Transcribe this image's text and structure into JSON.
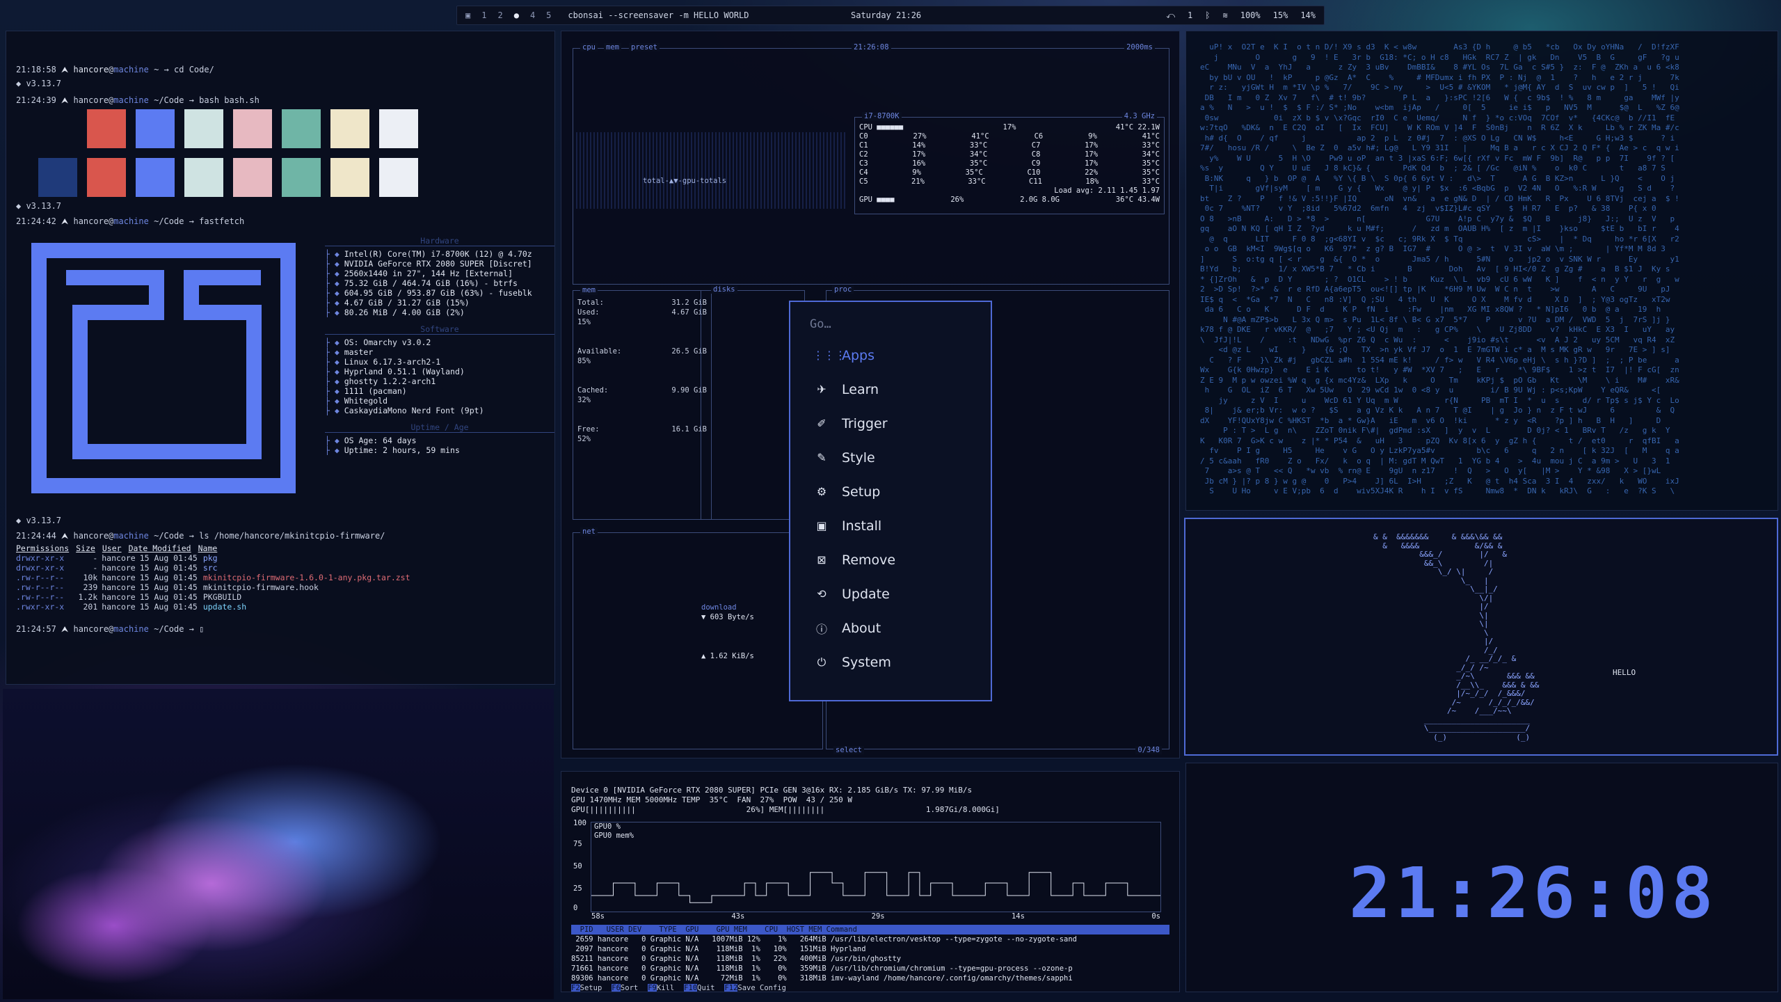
{
  "topbar": {
    "workspaces": [
      "1",
      "2",
      "3",
      "4",
      "5"
    ],
    "active_workspace": "3",
    "title": "cbonsai --screensaver -m HELLO WORLD",
    "clock": "Saturday 21:26",
    "right": [
      "1",
      "100%",
      "15%",
      "14%"
    ]
  },
  "terminal": {
    "lines": [
      {
        "time": "21:18:58",
        "user": "hancore",
        "host": "machine",
        "path": "~",
        "cmd": "cd Code/"
      },
      {
        "time": "21:24:39",
        "user": "hancore",
        "host": "machine",
        "path": "~/Code",
        "cmd": "bash bash.sh"
      }
    ],
    "version": "v3.13.7",
    "colors_row1": [
      "#d9564d",
      "#5c7bf2",
      "#cfe3e2",
      "#e7b9c1",
      "#6fb5a6",
      "#efe6c9",
      "#eceff5"
    ],
    "colors_row2": [
      "#1f3a7a",
      "#d9564d",
      "#5c7bf2",
      "#cfe3e2",
      "#e7b9c1",
      "#6fb5a6",
      "#efe6c9",
      "#eceff5"
    ],
    "fastfetch_prompt": {
      "time": "21:24:42",
      "user": "hancore",
      "host": "machine",
      "path": "~/Code",
      "cmd": "fastfetch"
    },
    "hardware_label": "Hardware",
    "hardware": [
      "Intel(R) Core(TM) i7-8700K (12) @ 4.70z",
      "NVIDIA GeForce RTX 2080 SUPER [Discret]",
      "2560x1440 in 27\", 144 Hz [External]",
      "75.32 GiB / 464.74 GiB (16%) - btrfs",
      "604.95 GiB / 953.87 GiB (63%) - fuseblk",
      "4.67 GiB / 31.27 GiB (15%)",
      "80.26 MiB / 4.00 GiB (2%)"
    ],
    "software_label": "Software",
    "software": [
      "OS: Omarchy v3.0.2",
      "master",
      "Linux 6.17.3-arch2-1",
      "Hyprland 0.51.1 (Wayland)",
      "ghostty 1.2.2-arch1",
      "1111 (pacman)",
      "Whitegold",
      "CaskaydiaMono Nerd Font (9pt)"
    ],
    "uptime_label": "Uptime / Age",
    "uptime": [
      "OS Age: 64 days",
      "Uptime: 2 hours, 59 mins"
    ],
    "ls_prompt": {
      "time": "21:24:44",
      "user": "hancore",
      "host": "machine",
      "path": "~/Code",
      "cmd": "ls /home/hancore/mkinitcpio-firmware/"
    },
    "ls_header": [
      "Permissions",
      "Size",
      "User",
      "Date Modified",
      "Name"
    ],
    "ls_rows": [
      {
        "perm": "drwxr-xr-x",
        "size": "-",
        "user": "hancore",
        "date": "15 Aug 01:45",
        "name": "pkg",
        "cls": "dir"
      },
      {
        "perm": "drwxr-xr-x",
        "size": "-",
        "user": "hancore",
        "date": "15 Aug 01:45",
        "name": "src",
        "cls": "dir"
      },
      {
        "perm": ".rw-r--r--",
        "size": "10k",
        "user": "hancore",
        "date": "15 Aug 01:45",
        "name": "mkinitcpio-firmware-1.6.0-1-any.pkg.tar.zst",
        "cls": "red"
      },
      {
        "perm": ".rw-r--r--",
        "size": "239",
        "user": "hancore",
        "date": "15 Aug 01:45",
        "name": "mkinitcpio-firmware.hook",
        "cls": ""
      },
      {
        "perm": ".rw-r--r--",
        "size": "1.2k",
        "user": "hancore",
        "date": "15 Aug 01:45",
        "name": "PKGBUILD",
        "cls": ""
      },
      {
        "perm": ".rwxr-xr-x",
        "size": "201",
        "user": "hancore",
        "date": "15 Aug 01:45",
        "name": "update.sh",
        "cls": "cyan"
      }
    ],
    "last_prompt": {
      "time": "21:24:57",
      "user": "hancore",
      "host": "machine",
      "path": "~/Code",
      "cmd": ""
    }
  },
  "btop": {
    "cpu_label": "cpu",
    "mem_label": "mem",
    "preset_label": "preset",
    "clock": "21:26:08",
    "interval": "2000ms",
    "cpu_name": "i7-8700K",
    "cpu_freq": "4.3 GHz",
    "cpu_total": "17%",
    "cpu_temp": "41°C",
    "cpu_power": "22.1W",
    "cores": [
      [
        "C0",
        "27%",
        "41°C",
        "C6",
        "9%",
        "41°C"
      ],
      [
        "C1",
        "14%",
        "33°C",
        "C7",
        "17%",
        "33°C"
      ],
      [
        "C2",
        "17%",
        "34°C",
        "C8",
        "17%",
        "34°C"
      ],
      [
        "C3",
        "16%",
        "35°C",
        "C9",
        "17%",
        "35°C"
      ],
      [
        "C4",
        "9%",
        "35°C",
        "C10",
        "22%",
        "35°C"
      ],
      [
        "C5",
        "21%",
        "33°C",
        "C11",
        "18%",
        "33°C"
      ]
    ],
    "load_avg": "Load avg: 2.11 1.45 1.97",
    "gpu_pct": "26%",
    "gpu_mem": "2.0G 8.0G",
    "gpu_temp": "36°C",
    "gpu_power": "43.4W",
    "graph_label": "total-▲▼-gpu-totals",
    "mem": {
      "total_label": "Total:",
      "total": "31.2 GiB",
      "used_label": "Used:",
      "used": "4.67 GiB",
      "used_pct": "15%",
      "avail_label": "Available:",
      "avail": "26.5 GiB",
      "avail_pct": "85%",
      "cached_label": "Cached:",
      "cached": "9.90 GiB",
      "cached_pct": "32%",
      "free_label": "Free:",
      "free": "16.1 GiB",
      "free_pct": "52%"
    },
    "disks_label": "disks",
    "proc_label": "proc",
    "net_label": "net",
    "download_label": "download",
    "download": "603 Byte/s",
    "upload": "1.62 KiB/s",
    "proc_footer": "select",
    "proc_count": "0/348"
  },
  "menu": {
    "placeholder": "Go…",
    "items": [
      {
        "label": "Apps",
        "icon": "apps-grid-icon",
        "glyph": "⋮⋮⋮"
      },
      {
        "label": "Learn",
        "icon": "learn-icon",
        "glyph": "✈"
      },
      {
        "label": "Trigger",
        "icon": "trigger-icon",
        "glyph": "✐"
      },
      {
        "label": "Style",
        "icon": "style-icon",
        "glyph": "✎"
      },
      {
        "label": "Setup",
        "icon": "setup-gear-icon",
        "glyph": "⚙"
      },
      {
        "label": "Install",
        "icon": "install-icon",
        "glyph": "▣"
      },
      {
        "label": "Remove",
        "icon": "remove-icon",
        "glyph": "⊠"
      },
      {
        "label": "Update",
        "icon": "update-icon",
        "glyph": "⟲"
      },
      {
        "label": "About",
        "icon": "about-icon",
        "glyph": "ⓘ"
      },
      {
        "label": "System",
        "icon": "power-icon",
        "glyph": "⏻"
      }
    ]
  },
  "nvtop": {
    "device": "Device 0 [NVIDIA GeForce RTX 2080 SUPER] PCIe GEN 3@16x RX: 2.185 GiB/s TX: 97.99 MiB/s",
    "clocks": "GPU 1470MHz MEM 5000MHz TEMP  35°C  FAN  27%  POW  43 / 250 W",
    "util": "GPU[||||||||||                        26%] MEM[||||||||                      1.987Gi/8.000Gi]",
    "y_ticks": [
      "100",
      "75",
      "50",
      "25",
      "0"
    ],
    "legend": [
      "GPU0 %",
      "GPU0 mem%"
    ],
    "x_ticks": [
      "58s",
      "43s",
      "29s",
      "14s",
      "0s"
    ],
    "graph_values": [
      18,
      18,
      32,
      32,
      18,
      18,
      32,
      32,
      18,
      10,
      10,
      18,
      18,
      18,
      32,
      18,
      32,
      32,
      18,
      18,
      44,
      44,
      32,
      18,
      18,
      44,
      44,
      18,
      18,
      44,
      18,
      32,
      32,
      18,
      18,
      18,
      32,
      32,
      18,
      18,
      44,
      44,
      18,
      18,
      32,
      18,
      18,
      32,
      32,
      18,
      18,
      18,
      18
    ],
    "proc_header": "  PID   USER DEV    TYPE  GPU    GPU MEM    CPU  HOST MEM Command",
    "proc_rows": [
      " 2659 hancore   0 Graphic N/A   1007MiB 12%    1%   264MiB /usr/lib/electron/vesktop --type=zygote --no-zygote-sand",
      " 2097 hancore   0 Graphic N/A    118MiB  1%   10%   151MiB Hyprland",
      "85211 hancore   0 Graphic N/A    118MiB  1%   22%   400MiB /usr/bin/ghostty",
      "71661 hancore   0 Graphic N/A    118MiB  1%    0%   359MiB /usr/lib/chromium/chromium --type=gpu-process --ozone-p",
      "89306 hancore   0 Graphic N/A     72MiB  1%    0%   318MiB imv-wayland /home/hancore/.config/omarchy/themes/sapphi"
    ],
    "keys": [
      [
        "F2",
        "Setup"
      ],
      [
        "F6",
        "Sort"
      ],
      [
        "F9",
        "Kill"
      ],
      [
        "F10",
        "Quit"
      ],
      [
        "F12",
        "Save Config"
      ]
    ]
  },
  "bonsai": {
    "message": "HELLO"
  },
  "clock": {
    "time": "21:26:08"
  }
}
